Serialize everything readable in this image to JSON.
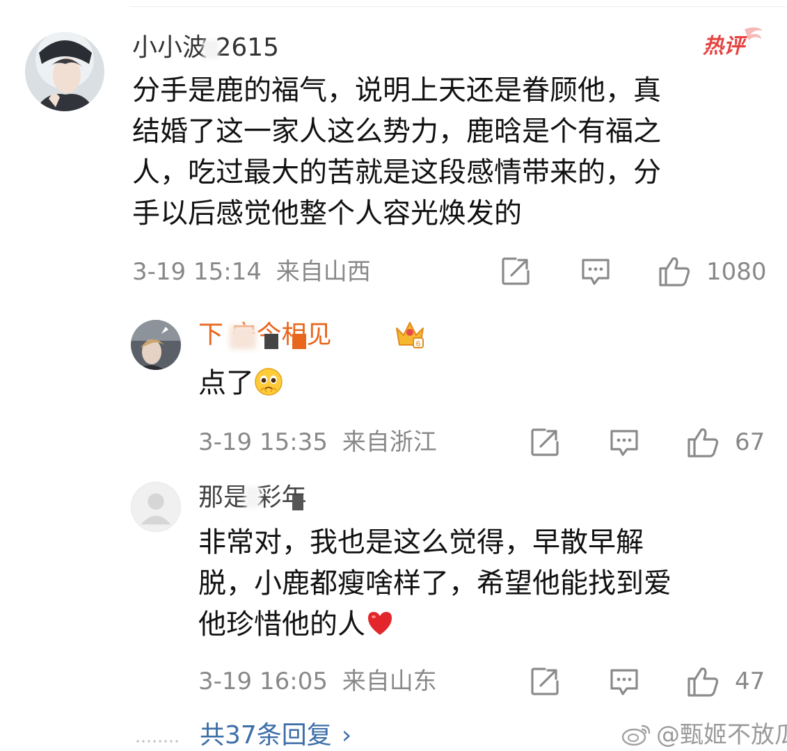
{
  "main_comment": {
    "username": "小小波 2615",
    "badge": "热评",
    "text_lines": [
      "分手是鹿的福气，说明上天还是眷顾他，真",
      "结婚了这一家人这么势力，鹿晗是个有福之",
      "人，吃过最大的苦就是这段感情带来的，分",
      "手以后感觉他整个人容光焕发的"
    ],
    "time": "3-19 15:14",
    "location": "来自山西",
    "likes": "1080",
    "icons": {
      "share": "share-icon",
      "comment": "comment-icon",
      "like": "thumbs-up-icon"
    }
  },
  "replies": [
    {
      "username": "下  宁今相见",
      "badge_icon": "vip-crown-icon",
      "text": "点了",
      "emoji": "pleading-emoji",
      "time": "3-19 15:35",
      "location": "来自浙江",
      "likes": "67"
    },
    {
      "username": "那是  彩年",
      "text_lines": [
        "非常对，我也是这么觉得，早散早解",
        "脱，小鹿都瘦啥样了，希望他能找到爱",
        "他珍惜他的人"
      ],
      "emoji": "red-heart-emoji",
      "time": "3-19 16:05",
      "location": "来自山东",
      "likes": "47"
    }
  ],
  "footer": {
    "more_replies": "共37条回复",
    "chevron": "›",
    "watermark": "@甄姬不放瓜"
  },
  "colors": {
    "vip_name": "#e8661d",
    "link_blue": "#3d6ea8",
    "meta_gray": "#888888",
    "hot_red": "#e64340"
  }
}
